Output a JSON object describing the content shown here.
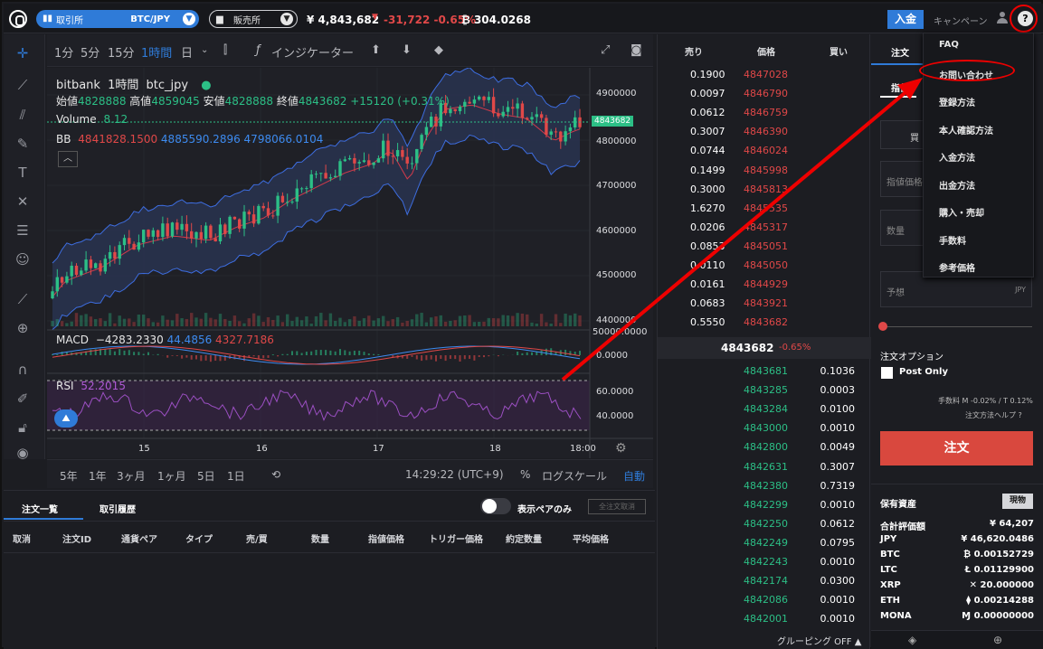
{
  "topbar": {
    "trade_label": "取引所",
    "pair": "BTC/JPY",
    "shop_label": "販売所",
    "price": "¥ 4,843,682",
    "change": "-31,722 -0.65%",
    "btc_balance": "₿ 304.0268",
    "deposit": "入金",
    "campaign": "キャンペーン"
  },
  "help_menu": [
    "FAQ",
    "お問い合わせ",
    "登録方法",
    "本人確認方法",
    "入金方法",
    "出金方法",
    "購入・売却",
    "手数料",
    "参考価格"
  ],
  "chart_toolbar": {
    "intervals": [
      "1分",
      "5分",
      "15分",
      "1時間",
      "日"
    ],
    "active_interval": "1時間",
    "indicator": "インジケーター"
  },
  "chart": {
    "exchange": "bitbank",
    "interval": "1時間",
    "symbol": "btc_jpy",
    "ohlc_open_label": "始値",
    "ohlc_open": "4828888",
    "ohlc_high_label": "高値",
    "ohlc_high": "4859045",
    "ohlc_low_label": "安値",
    "ohlc_low": "4828888",
    "ohlc_close_label": "終値",
    "ohlc_close": "4843682",
    "ohlc_change": "+15120 (+0.31%)",
    "volume_label": "Volume",
    "volume_value": "8.12",
    "bb_label": "BB",
    "bb_1": "4841828.1500",
    "bb_2": "4885590.2896",
    "bb_3": "4798066.0104",
    "macd_label": "MACD",
    "macd_1": "−4283.2330",
    "macd_2": "44.4856",
    "macd_3": "4327.7186",
    "rsi_label": "RSI",
    "rsi_value": "52.2015",
    "price_axis": [
      "4900000",
      "4800000",
      "4700000",
      "4600000",
      "4500000",
      "4400000"
    ],
    "current_price_tag": "4843682",
    "macd_axis": [
      "50000.0000",
      "0.0000"
    ],
    "rsi_axis": [
      "60.0000",
      "40.0000"
    ],
    "time_axis": [
      "15",
      "16",
      "17",
      "18",
      "18:00"
    ],
    "colors": {
      "up": "#2cbf86",
      "down": "#e04848",
      "bb_band": "#2f3a5a"
    }
  },
  "chart_data": {
    "type": "candlestick",
    "title": "",
    "symbol": "btc_jpy",
    "y_range": [
      4400000,
      4930000
    ],
    "current_price": 4843682,
    "x_ticks": [
      "15",
      "16",
      "17",
      "18",
      "18:00"
    ]
  },
  "timeframe_bar": {
    "ranges": [
      "5年",
      "1年",
      "3ヶ月",
      "1ヶ月",
      "5日",
      "1日"
    ],
    "clock": "14:29:22 (UTC+9)",
    "percent": "%",
    "log": "ログスケール",
    "auto": "自動"
  },
  "orders": {
    "tab_active": "注文一覧",
    "tab_history": "取引履歴",
    "pair_only": "表示ペアのみ",
    "cancel_all": "全注文取消",
    "headers": [
      "取消",
      "注文ID",
      "通貨ペア",
      "タイプ",
      "売/買",
      "数量",
      "指値価格",
      "トリガー価格",
      "約定数量",
      "平均価格"
    ]
  },
  "book": {
    "headers": {
      "sell": "売り",
      "price": "価格",
      "buy": "買い"
    },
    "asks": [
      {
        "q": "0.1900",
        "p": "4847028"
      },
      {
        "q": "0.0097",
        "p": "4846790"
      },
      {
        "q": "0.0612",
        "p": "4846759"
      },
      {
        "q": "0.3007",
        "p": "4846390"
      },
      {
        "q": "0.0744",
        "p": "4846024"
      },
      {
        "q": "0.1499",
        "p": "4845998"
      },
      {
        "q": "0.3000",
        "p": "4845813"
      },
      {
        "q": "1.6270",
        "p": "4845535"
      },
      {
        "q": "0.0206",
        "p": "4845317"
      },
      {
        "q": "0.0853",
        "p": "4845051"
      },
      {
        "q": "0.0110",
        "p": "4845050"
      },
      {
        "q": "0.0161",
        "p": "4844929"
      },
      {
        "q": "0.0683",
        "p": "4843921"
      },
      {
        "q": "0.5550",
        "p": "4843682"
      }
    ],
    "mid_price": "4843682",
    "mid_change": "-0.65%",
    "bids": [
      {
        "p": "4843681",
        "q": "0.1036"
      },
      {
        "p": "4843285",
        "q": "0.0003"
      },
      {
        "p": "4843284",
        "q": "0.0100"
      },
      {
        "p": "4843000",
        "q": "0.0010"
      },
      {
        "p": "4842800",
        "q": "0.0049"
      },
      {
        "p": "4842631",
        "q": "0.3007"
      },
      {
        "p": "4842380",
        "q": "0.7319"
      },
      {
        "p": "4842299",
        "q": "0.0010"
      },
      {
        "p": "4842250",
        "q": "0.0612"
      },
      {
        "p": "4842249",
        "q": "0.0795"
      },
      {
        "p": "4842243",
        "q": "0.0010"
      },
      {
        "p": "4842174",
        "q": "0.0300"
      },
      {
        "p": "4842086",
        "q": "0.0010"
      },
      {
        "p": "4842001",
        "q": "0.0010"
      }
    ],
    "grouping": "グルーピング OFF"
  },
  "order_form": {
    "tab": "注文",
    "order_type": "指値",
    "buy_short": "買",
    "limit_price_placeholder": "指値価格",
    "quantity_placeholder": "数量",
    "estimate": "予想",
    "estimate_unit": "JPY",
    "options": "注文オプション",
    "post_only": "Post Only",
    "fee": "手数料 M -0.02% / T 0.12%",
    "help": "注文方法ヘルプ",
    "submit": "注文"
  },
  "holdings": {
    "title": "保有資産",
    "badge": "現物",
    "rows": [
      {
        "label": "合計評価額",
        "value": "¥ 64,207"
      },
      {
        "label": "JPY",
        "value": "¥ 46,620.0486"
      },
      {
        "label": "BTC",
        "value": "₿ 0.00152729"
      },
      {
        "label": "LTC",
        "value": "Ł 0.01129900"
      },
      {
        "label": "XRP",
        "value": "✕ 20.000000"
      },
      {
        "label": "ETH",
        "value": "⧫ 0.00214288"
      },
      {
        "label": "MONA",
        "value": "Ɱ 0.00000000"
      }
    ]
  }
}
